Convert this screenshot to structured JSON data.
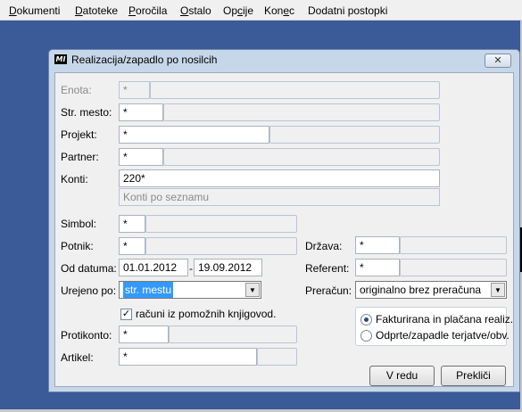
{
  "menu": {
    "items": [
      "Dokumenti",
      "Datoteke",
      "Poročila",
      "Ostalo",
      "Opcije",
      "Konec",
      "Dodatni postopki"
    ],
    "underlined": [
      "D",
      "D",
      "P",
      "O",
      "c",
      "c",
      ""
    ],
    "rest": [
      "okumenti",
      "atoteke",
      "oročila",
      "stalo",
      "Op|ije",
      "Kon|e",
      "Dodatni postopki"
    ]
  },
  "dialog": {
    "app_icon": "MI",
    "title": "Realizacija/zapadlo po nosilcih",
    "close_glyph": "✕",
    "fields": {
      "enota": {
        "label": "Enota:",
        "value": "*"
      },
      "str_mesto": {
        "label": "Str. mesto:",
        "value": "*"
      },
      "projekt": {
        "label": "Projekt:",
        "value": "*"
      },
      "partner": {
        "label": "Partner:",
        "value": "*"
      },
      "konti": {
        "label": "Konti:",
        "value": "220*",
        "hint": "Konti po seznamu"
      },
      "simbol": {
        "label": "Simbol:",
        "value": "*"
      },
      "potnik": {
        "label": "Potnik:",
        "value": "*"
      },
      "od_datuma": {
        "label": "Od datuma:",
        "from": "01.01.2012",
        "separator": "-",
        "to": "19.09.2012"
      },
      "urejeno_po": {
        "label": "Urejeno po:",
        "value": "str. mestu"
      },
      "racuni_pomoznih": {
        "label": "računi iz pomožnih knjigovod.",
        "checked": true
      },
      "protikonto": {
        "label": "Protikonto:",
        "value": "*"
      },
      "artikel": {
        "label": "Artikel:",
        "value": "*"
      },
      "drzava": {
        "label": "Država:",
        "value": "*"
      },
      "referent": {
        "label": "Referent:",
        "value": "*"
      },
      "preracun": {
        "label": "Preračun:",
        "value": "originalno brez preračuna"
      }
    },
    "radio_options": [
      {
        "label": "Fakturirana in plačana realiz.",
        "selected": true
      },
      {
        "label": "Odprte/zapadle terjatve/obv.",
        "selected": false
      }
    ],
    "buttons": {
      "ok": "V redu",
      "cancel": "Prekliči"
    }
  }
}
